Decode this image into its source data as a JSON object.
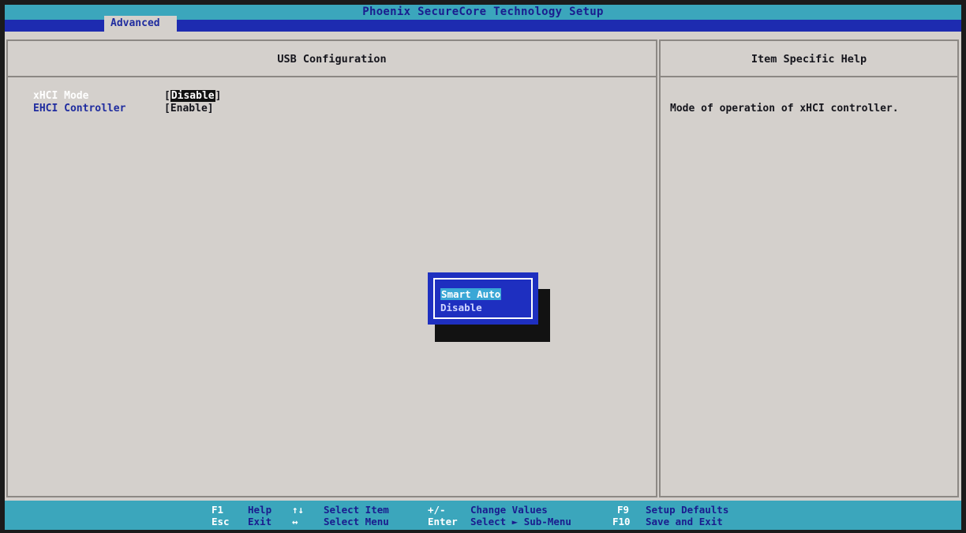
{
  "header": {
    "title": "Phoenix SecureCore Technology Setup",
    "active_tab": "Advanced"
  },
  "main": {
    "section_title": "USB Configuration",
    "settings": [
      {
        "label": "xHCI Mode",
        "value_open": "[",
        "value": "Disable",
        "value_close": "]"
      },
      {
        "label": "EHCI Controller",
        "value": "[Enable]"
      }
    ]
  },
  "help": {
    "title": "Item Specific Help",
    "text": "Mode of operation of xHCI controller."
  },
  "popup": {
    "options": [
      "Smart Auto",
      "Disable"
    ],
    "selected": "Smart Auto"
  },
  "footer": {
    "row1": [
      {
        "key": "F1",
        "desc": "Help"
      },
      {
        "key": "↑↓",
        "desc": "Select Item"
      },
      {
        "key": "+/-",
        "desc": "Change Values"
      },
      {
        "key": "F9",
        "desc": "Setup Defaults"
      }
    ],
    "row2": [
      {
        "key": "Esc",
        "desc": "Exit"
      },
      {
        "key": "↔",
        "desc": "Select Menu"
      },
      {
        "key": "Enter",
        "desc": "Select ► Sub-Menu"
      },
      {
        "key": "F10",
        "desc": "Save and Exit"
      }
    ]
  },
  "colors": {
    "title_bar": "#3ba6bc",
    "tab_bar": "#1d2bb0",
    "panel_bg": "#d4d0cc",
    "popup_bg": "#1e2fc0",
    "label_blue": "#1f2c9f"
  }
}
